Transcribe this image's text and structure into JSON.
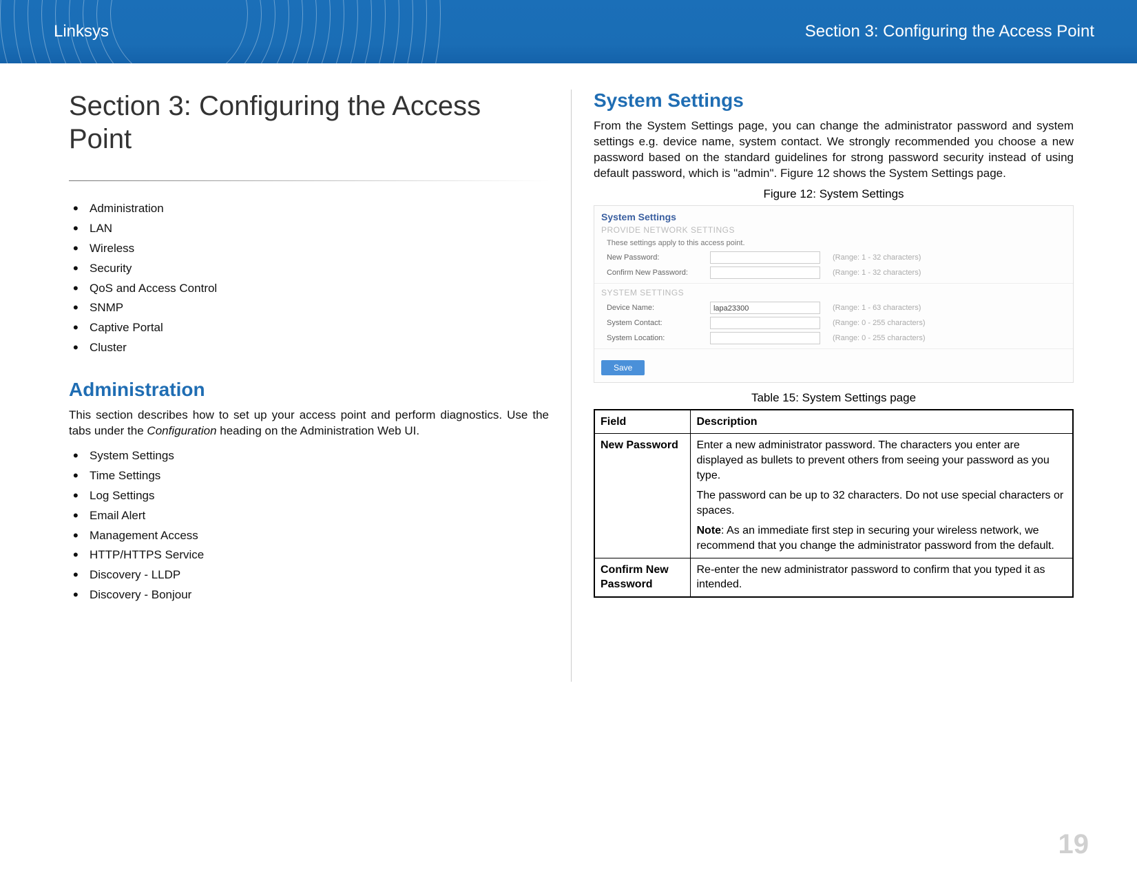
{
  "header": {
    "brand": "Linksys",
    "section": "Section 3:  Configuring the Access Point"
  },
  "page_number": "19",
  "left": {
    "title": "Section 3:  Configuring the Access Point",
    "toc": [
      "Administration",
      "LAN",
      "Wireless",
      "Security",
      "QoS and Access Control",
      "SNMP",
      "Captive Portal",
      "Cluster"
    ],
    "admin": {
      "heading": "Administration",
      "para_a": "This section describes how to set up your access point and perform diagnostics. Use the tabs under the ",
      "para_em": "Configuration",
      "para_b": " heading on the Administration Web UI.",
      "items": [
        "System Settings",
        "Time Settings",
        "Log Settings",
        "Email Alert",
        "Management Access",
        "HTTP/HTTPS Service",
        "Discovery - LLDP",
        "Discovery - Bonjour"
      ]
    }
  },
  "right": {
    "heading": "System Settings",
    "para": "From the System Settings page, you can change the administrator password and system settings e.g. device name, system contact. We strongly recommended you choose a new password based on the standard guidelines for strong password security instead of using default password, which is \"admin\". Figure 12 shows the System Settings page.",
    "figure_caption": "Figure 12: System Settings",
    "shot": {
      "title": "System Settings",
      "group1": "PROVIDE NETWORK SETTINGS",
      "note": "These settings apply to this access point.",
      "rows1": [
        {
          "label": "New Password:",
          "value": "",
          "hint": "(Range: 1 - 32 characters)"
        },
        {
          "label": "Confirm New Password:",
          "value": "",
          "hint": "(Range: 1 - 32 characters)"
        }
      ],
      "group2": "SYSTEM SETTINGS",
      "rows2": [
        {
          "label": "Device Name:",
          "value": "lapa23300",
          "hint": "(Range: 1 - 63 characters)"
        },
        {
          "label": "System Contact:",
          "value": "",
          "hint": "(Range: 0 - 255 characters)"
        },
        {
          "label": "System Location:",
          "value": "",
          "hint": "(Range: 0 - 255 characters)"
        }
      ],
      "save": "Save"
    },
    "table_caption": "Table 15: System Settings page",
    "table": {
      "head": {
        "field": "Field",
        "desc": "Description"
      },
      "rows": [
        {
          "field": "New Password",
          "p1": "Enter a new administrator password. The characters you enter are displayed as bullets to prevent others from seeing your password as you type.",
          "p2": "The password can be up to 32 characters. Do not use special characters or spaces.",
          "note_label": "Note",
          "note_text": ":  As an immediate first step in securing your wireless network, we recommend that you change the administrator password from the default."
        },
        {
          "field": "Confirm New Password",
          "p1": "Re-enter the new administrator password to confirm that you typed it as intended."
        }
      ]
    }
  }
}
